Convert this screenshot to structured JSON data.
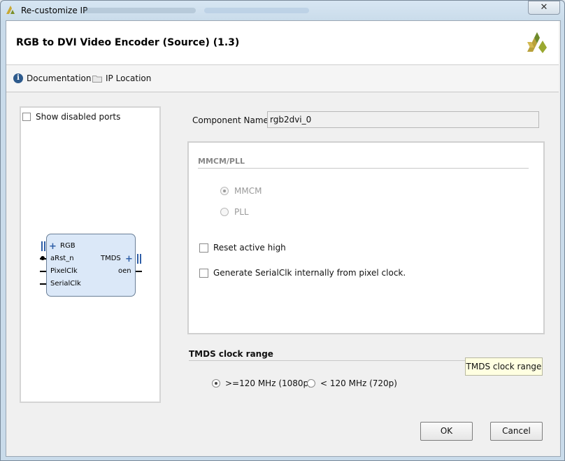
{
  "window": {
    "title": "Re-customize IP",
    "close_label": "✕"
  },
  "header": {
    "title": "RGB to DVI Video Encoder (Source) (1.3)"
  },
  "toolbar": {
    "documentation_label": "Documentation",
    "ip_location_label": "IP Location"
  },
  "left_panel": {
    "show_disabled_ports_label": "Show disabled ports",
    "show_disabled_ports_checked": false,
    "block": {
      "left_ports": [
        "RGB",
        "aRst_n",
        "PixelClk",
        "SerialClk"
      ],
      "right_ports": [
        "TMDS",
        "oen"
      ]
    }
  },
  "component": {
    "label": "Component Name",
    "value": "rgb2dvi_0"
  },
  "mmcm_pll": {
    "title": "MMCM/PLL",
    "options": [
      "MMCM",
      "PLL"
    ],
    "selected": "MMCM",
    "reset_active_high_label": "Reset active high",
    "reset_active_high_checked": false,
    "generate_serialclk_label": "Generate SerialClk internally from pixel clock.",
    "generate_serialclk_checked": false
  },
  "tmds": {
    "title": "TMDS clock range",
    "options": [
      ">=120 MHz (1080p)",
      "< 120 MHz (720p)"
    ],
    "selected": ">=120 MHz (1080p)",
    "tooltip": "TMDS clock range"
  },
  "buttons": {
    "ok": "OK",
    "cancel": "Cancel"
  },
  "colors": {
    "block_fill": "#dbe8f8",
    "bus_blue": "#2f5fa8",
    "tooltip_bg": "#ffffe1"
  }
}
